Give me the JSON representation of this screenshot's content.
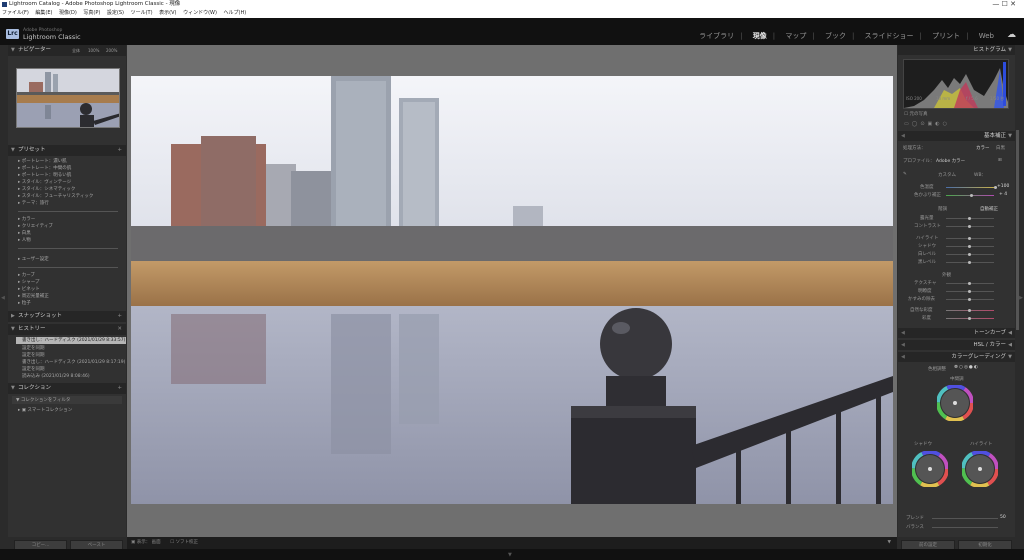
{
  "titlebar": {
    "title": "Lightroom Catalog - Adobe Photoshop Lightroom Classic - 現像",
    "controls": "—   ☐   ✕"
  },
  "menubar": [
    "ファイル(F)",
    "編集(E)",
    "現像(D)",
    "写真(P)",
    "設定(S)",
    "ツール(T)",
    "表示(V)",
    "ウィンドウ(W)",
    "ヘルプ(H)"
  ],
  "brand": {
    "logo": "Lrc",
    "line1": "Adobe Photoshop",
    "line2": "Lightroom Classic"
  },
  "modules": [
    "ライブラリ",
    "現像",
    "マップ",
    "ブック",
    "スライドショー",
    "プリント",
    "Web"
  ],
  "active_module": "現像",
  "left": {
    "navigator": {
      "title": "ナビゲーター",
      "zoom": [
        "全体",
        "100%",
        "200%"
      ]
    },
    "presets": {
      "title": "プリセット",
      "items": [
        "ポートレート：濃い肌",
        "ポートレート：中間の肌",
        "ポートレート：明るい肌",
        "スタイル：ヴィンテージ",
        "スタイル：シネマティック",
        "スタイル：フューチャリスティック",
        "テーマ：旅行",
        "カラー",
        "クリエイティブ",
        "白黒",
        "人物",
        "ユーザー設定",
        "カーブ",
        "シャープ",
        "ビネット",
        "周辺光量補正",
        "粒子"
      ]
    },
    "snapshots": {
      "title": "スナップショット"
    },
    "history": {
      "title": "ヒストリー",
      "items": [
        "書き出し：ハードディスク (2021/01/29 8:33:57)",
        "設定を同期",
        "設定を同期",
        "書き出し：ハードディスク (2021/01/29 8:17:19)",
        "設定を同期",
        "読み込み (2021/01/29 8:08:46)"
      ]
    },
    "collections": {
      "title": "コレクション",
      "filter": "コレクションをフィルタ",
      "smart": "スマートコレクション"
    },
    "buttons": {
      "copy": "コピー...",
      "paste": "ペースト"
    }
  },
  "right": {
    "histogram": {
      "title": "ヒストグラム",
      "iso": "ISO 200",
      "focal": "18 mm",
      "aperture": "f / 5.6",
      "shutter": "1/50 秒",
      "original": "元の写真"
    },
    "basic": {
      "title": "基本補正",
      "treatment": "処理方法：",
      "color": "カラー",
      "bw": "白黒",
      "profile_label": "プロファイル：",
      "profile": "Adobe カラー",
      "wb_label": "WB：",
      "wb": "カスタム",
      "temp": "色温度",
      "temp_val": "+100",
      "tint": "色かぶり補正",
      "tint_val": "+ 4",
      "tone": "階調",
      "auto": "自動補正",
      "exposure": "露光量",
      "contrast": "コントラスト",
      "highlights": "ハイライト",
      "shadows": "シャドウ",
      "whites": "白レベル",
      "blacks": "黒レベル",
      "presence": "外観",
      "texture": "テクスチャ",
      "clarity": "明瞭度",
      "dehaze": "かすみの除去",
      "vibrance": "自然な彩度",
      "saturation": "彩度"
    },
    "tonecurve": {
      "title": "トーンカーブ"
    },
    "hsl": {
      "title": "HSL / カラー"
    },
    "colorgrading": {
      "title": "カラーグレーディング",
      "adjust": "色相調整",
      "midtones": "中間調",
      "shadows": "シャドウ",
      "highlights": "ハイライト",
      "blending": "ブレンド",
      "balance": "バランス",
      "blend_val": "50"
    },
    "buttons": {
      "prev": "前の設定",
      "reset": "初期化"
    }
  },
  "toolbar": {
    "label": "表示：",
    "mode": "画面",
    "softproof": "ソフト校正"
  }
}
